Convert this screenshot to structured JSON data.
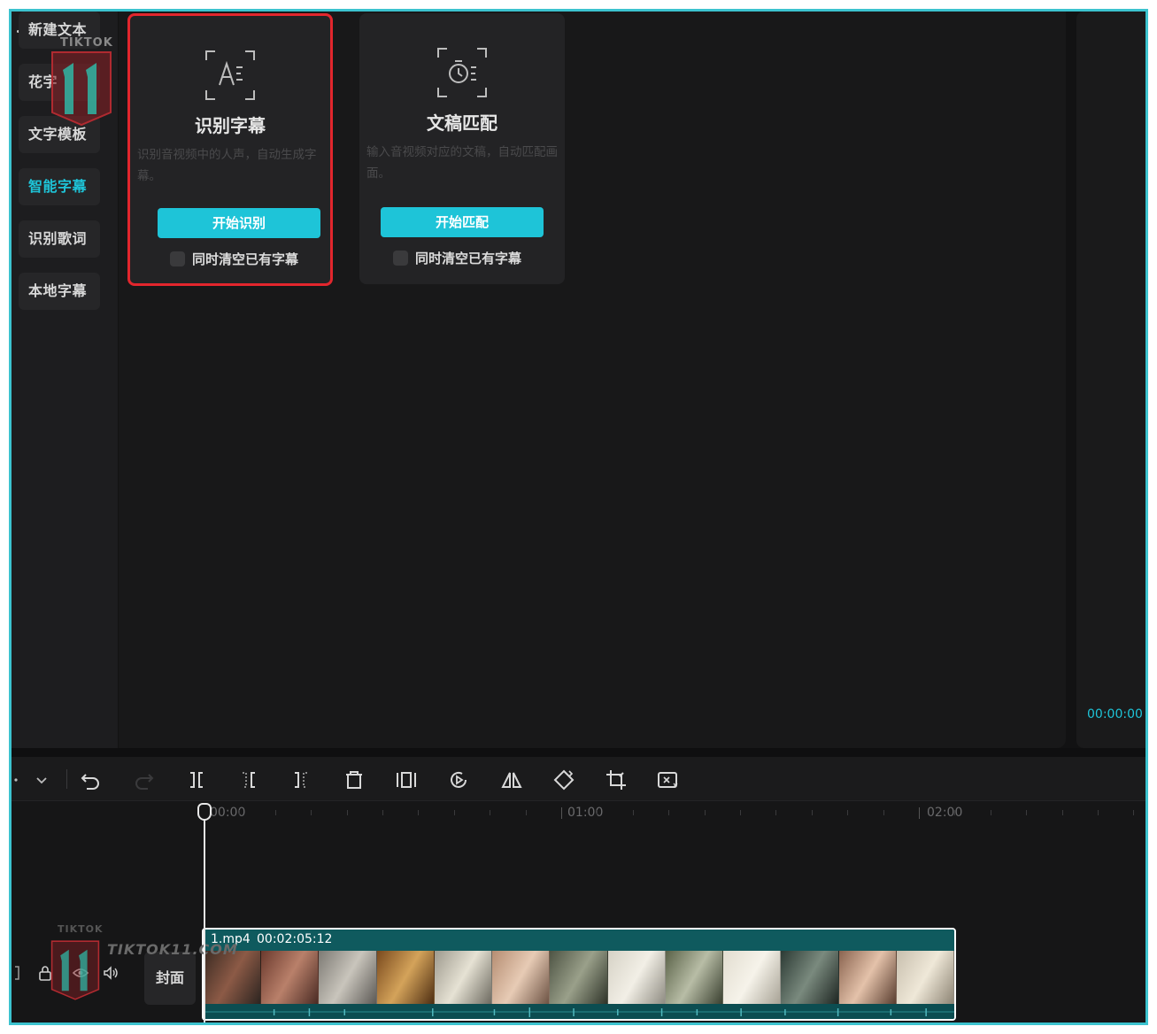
{
  "nav": {
    "items": [
      {
        "label": "新建文本",
        "active": false
      },
      {
        "label": "花字",
        "active": false
      },
      {
        "label": "文字模板",
        "active": false
      },
      {
        "label": "智能字幕",
        "active": true
      },
      {
        "label": "识别歌词",
        "active": false
      },
      {
        "label": "本地字幕",
        "active": false
      }
    ]
  },
  "cards": {
    "recognize": {
      "icon": "text-recognition-icon",
      "title": "识别字幕",
      "desc": "识别音视频中的人声，自动生成字幕。",
      "button": "开始识别",
      "checkbox_label": "同时清空已有字幕"
    },
    "match": {
      "icon": "timer-text-icon",
      "title": "文稿匹配",
      "desc": "输入音视频对应的文稿，自动匹配画面。",
      "button": "开始匹配",
      "checkbox_label": "同时清空已有字幕"
    }
  },
  "preview": {
    "time": "00:00:00"
  },
  "toolbar": {
    "icons": [
      "select-cursor-icon",
      "chevron-down-icon",
      "undo-icon",
      "redo-icon",
      "split-icon",
      "split-left-icon",
      "split-right-icon",
      "delete-icon",
      "freeze-frame-icon",
      "reverse-play-icon",
      "mirror-icon",
      "rotate-icon",
      "crop-icon",
      "auto-reframe-icon"
    ]
  },
  "ruler": {
    "labels": [
      "00:00",
      "01:00",
      "02:00"
    ]
  },
  "track": {
    "cover_label": "封面",
    "clip_name": "1.mp4",
    "clip_duration": "00:02:05:12"
  },
  "watermark": {
    "brand": "TIKTOK",
    "number": "11",
    "site": "TIKTOK11.COM"
  },
  "colors": {
    "accent": "#1ec4d8",
    "highlight": "#e2262d",
    "clip": "#0f5a5e",
    "frame": "#3cc3cf"
  }
}
